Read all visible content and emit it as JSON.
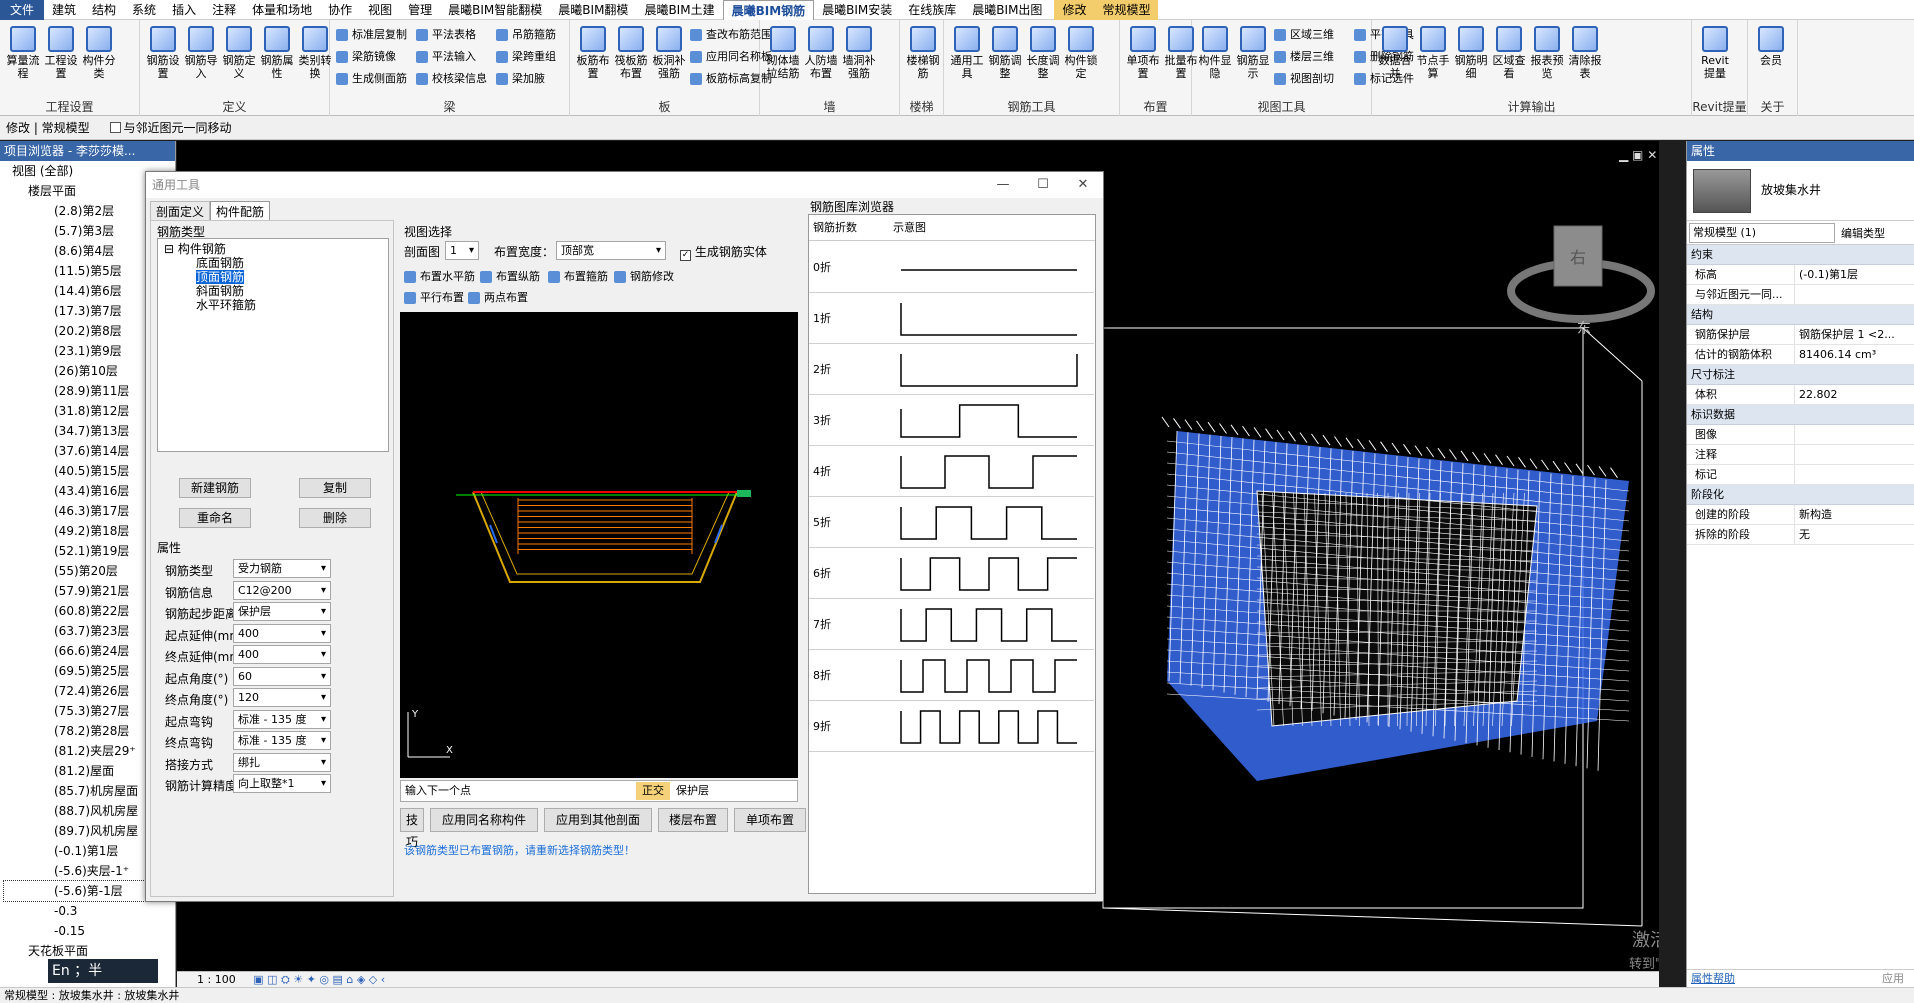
{
  "menubar": {
    "file": "文件",
    "tabs": [
      "建筑",
      "结构",
      "系统",
      "插入",
      "注释",
      "体量和场地",
      "协作",
      "视图",
      "管理",
      "晨曦BIM智能翻模",
      "晨曦BIM翻模",
      "晨曦BIM土建",
      "晨曦BIM钢筋",
      "晨曦BIM安装",
      "在线族库",
      "晨曦BIM出图"
    ],
    "active": "晨曦BIM钢筋",
    "modify": "修改",
    "context": "常规模型"
  },
  "ribbon": {
    "groups": [
      {
        "title": "工程设置",
        "big": [
          "算量流程",
          "工程设置",
          "构件分类"
        ],
        "small": []
      },
      {
        "title": "定义",
        "big": [
          "钢筋设置",
          "钢筋导入",
          "钢筋定义",
          "钢筋属性",
          "类别转换"
        ],
        "small": []
      },
      {
        "title": "梁",
        "big": [],
        "small": [
          "标准层复制",
          "梁筋镜像",
          "生成侧面筋",
          "平法表格",
          "平法输入",
          "校核梁信息",
          "吊筋箍筋",
          "梁跨重组",
          "梁加腋"
        ]
      },
      {
        "title": "板",
        "big": [
          "板筋布置",
          "筏板筋布置",
          "板洞补强筋"
        ],
        "small": [
          "查改布筋范围",
          "应用同名称板",
          "板筋标高复制"
        ]
      },
      {
        "title": "墙",
        "big": [
          "砌体墙拉结筋",
          "人防墙布置",
          "墙洞补强筋"
        ],
        "small": []
      },
      {
        "title": "楼梯",
        "big": [
          "楼梯钢筋"
        ],
        "small": []
      },
      {
        "title": "钢筋工具",
        "big": [
          "通用工具",
          "钢筋调整",
          "长度调整",
          "构件锁定"
        ],
        "small": []
      },
      {
        "title": "布置",
        "big": [
          "单项布置",
          "批量布置"
        ],
        "small": []
      },
      {
        "title": "视图工具",
        "big": [
          "构件显隐",
          "钢筋显示"
        ],
        "small": [
          "区域三维",
          "楼层三维",
          "视图剖切",
          "平齐工具",
          "删除钢筋",
          "标记选件"
        ]
      },
      {
        "title": "计算输出",
        "big": [
          "数据合并",
          "节点手算",
          "钢筋明细",
          "区域查看",
          "报表预览",
          "清除报表"
        ],
        "small": []
      },
      {
        "title": "Revit提量",
        "big": [
          "Revit提量"
        ],
        "small": []
      },
      {
        "title": "关于",
        "big": [
          "会员"
        ],
        "small": []
      }
    ]
  },
  "optbar": {
    "mode": "修改 | 常规模型",
    "checkbox": "与邻近图元一同移动"
  },
  "left_panel": {
    "title": "项目浏览器 - 李莎莎模...",
    "root": "视图 (全部)",
    "sub": "楼层平面",
    "levels": [
      "(2.8)第2层",
      "(5.7)第3层",
      "(8.6)第4层",
      "(11.5)第5层",
      "(14.4)第6层",
      "(17.3)第7层",
      "(20.2)第8层",
      "(23.1)第9层",
      "(26)第10层",
      "(28.9)第11层",
      "(31.8)第12层",
      "(34.7)第13层",
      "(37.6)第14层",
      "(40.5)第15层",
      "(43.4)第16层",
      "(46.3)第17层",
      "(49.2)第18层",
      "(52.1)第19层",
      "(55)第20层",
      "(57.9)第21层",
      "(60.8)第22层",
      "(63.7)第23层",
      "(66.6)第24层",
      "(69.5)第25层",
      "(72.4)第26层",
      "(75.3)第27层",
      "(78.2)第28层",
      "(81.2)夹层29⁺",
      "(81.2)屋面",
      "(85.7)机房屋面",
      "(88.7)风机房屋",
      "(89.7)风机房屋",
      "(-0.1)第1层",
      "(-5.6)夹层-1⁺",
      "(-5.6)第-1层",
      "-0.3",
      "-0.15"
    ],
    "ceiling": "天花板平面",
    "ime": "En ；半"
  },
  "dialog": {
    "title": "通用工具",
    "tabs": [
      "剖面定义",
      "构件配筋"
    ],
    "rebar_type_group": "钢筋类型",
    "tree_root": "构件钢筋",
    "tree_items": [
      "底面钢筋",
      "顶面钢筋",
      "斜面钢筋",
      "水平环箍筋"
    ],
    "selected_item": "顶面钢筋",
    "buttons": [
      "新建钢筋",
      "复制",
      "重命名",
      "删除"
    ],
    "props_title": "属性",
    "props": [
      {
        "k": "钢筋类型",
        "v": "受力钢筋"
      },
      {
        "k": "钢筋信息",
        "v": "C12@200"
      },
      {
        "k": "钢筋起步距离",
        "v": "保护层"
      },
      {
        "k": "起点延伸(mm)",
        "v": "400"
      },
      {
        "k": "终点延伸(mm)",
        "v": "400"
      },
      {
        "k": "起点角度(°)",
        "v": "60"
      },
      {
        "k": "终点角度(°)",
        "v": "120"
      },
      {
        "k": "起点弯钩",
        "v": "标准 - 135 度"
      },
      {
        "k": "终点弯钩",
        "v": "标准 - 135 度"
      },
      {
        "k": "搭接方式",
        "v": "绑扎"
      },
      {
        "k": "钢筋计算精度",
        "v": "向上取整*1"
      }
    ],
    "view_select": "视图选择",
    "section_label": "剖面图",
    "section_value": "1",
    "width_label": "布置宽度：",
    "width_value": "顶部宽",
    "gen_solid": "生成钢筋实体",
    "tools": [
      "布置水平筋",
      "布置纵筋",
      "布置箍筋",
      "钢筋修改",
      "平行布置",
      "两点布置"
    ],
    "cmd_placeholder": "输入下一个点",
    "ortho": "正交",
    "cover": "保护层",
    "bottom_buttons": [
      "技巧",
      "应用同名称构件",
      "应用到其他剖面",
      "楼层布置",
      "单项布置"
    ],
    "hint": "该钢筋类型已布置钢筋，请重新选择钢筋类型！",
    "gallery_title": "钢筋图库浏览器",
    "gallery_headers": [
      "钢筋折数",
      "示意图"
    ],
    "gallery_rows": [
      "0折",
      "1折",
      "2折",
      "3折",
      "4折",
      "5折",
      "6折",
      "7折",
      "8折",
      "9折"
    ]
  },
  "right_panel": {
    "title": "属性",
    "family": "放坡集水井",
    "type": "常规模型 (1)",
    "edit_type": "编辑类型",
    "sections": [
      {
        "name": "约束",
        "rows": [
          {
            "k": "标高",
            "v": "(-0.1)第1层"
          },
          {
            "k": "与邻近图元一同...",
            "v": ""
          }
        ]
      },
      {
        "name": "结构",
        "rows": [
          {
            "k": "钢筋保护层",
            "v": "钢筋保护层 1 <2..."
          },
          {
            "k": "估计的钢筋体积",
            "v": "81406.14 cm³"
          }
        ]
      },
      {
        "name": "尺寸标注",
        "rows": [
          {
            "k": "体积",
            "v": "22.802"
          }
        ]
      },
      {
        "name": "标识数据",
        "rows": [
          {
            "k": "图像",
            "v": ""
          },
          {
            "k": "注释",
            "v": ""
          },
          {
            "k": "标记",
            "v": ""
          }
        ]
      },
      {
        "name": "阶段化",
        "rows": [
          {
            "k": "创建的阶段",
            "v": "新构造"
          },
          {
            "k": "拆除的阶段",
            "v": "无"
          }
        ]
      }
    ],
    "help": "属性帮助",
    "apply": "应用"
  },
  "viewport": {
    "cube_label": "右",
    "cube_compass": "东",
    "scale": "1 : 100",
    "watermark1": "激活 Windows",
    "watermark2": "转到\"设置\"以激活 Windows。"
  },
  "status": {
    "text": "常规模型 : 放坡集水井 : 放坡集水井"
  },
  "colors": {
    "accent": "#3966a6",
    "rebar_blue": "#3a6cf0",
    "active_tab": "#1e4e9c"
  }
}
